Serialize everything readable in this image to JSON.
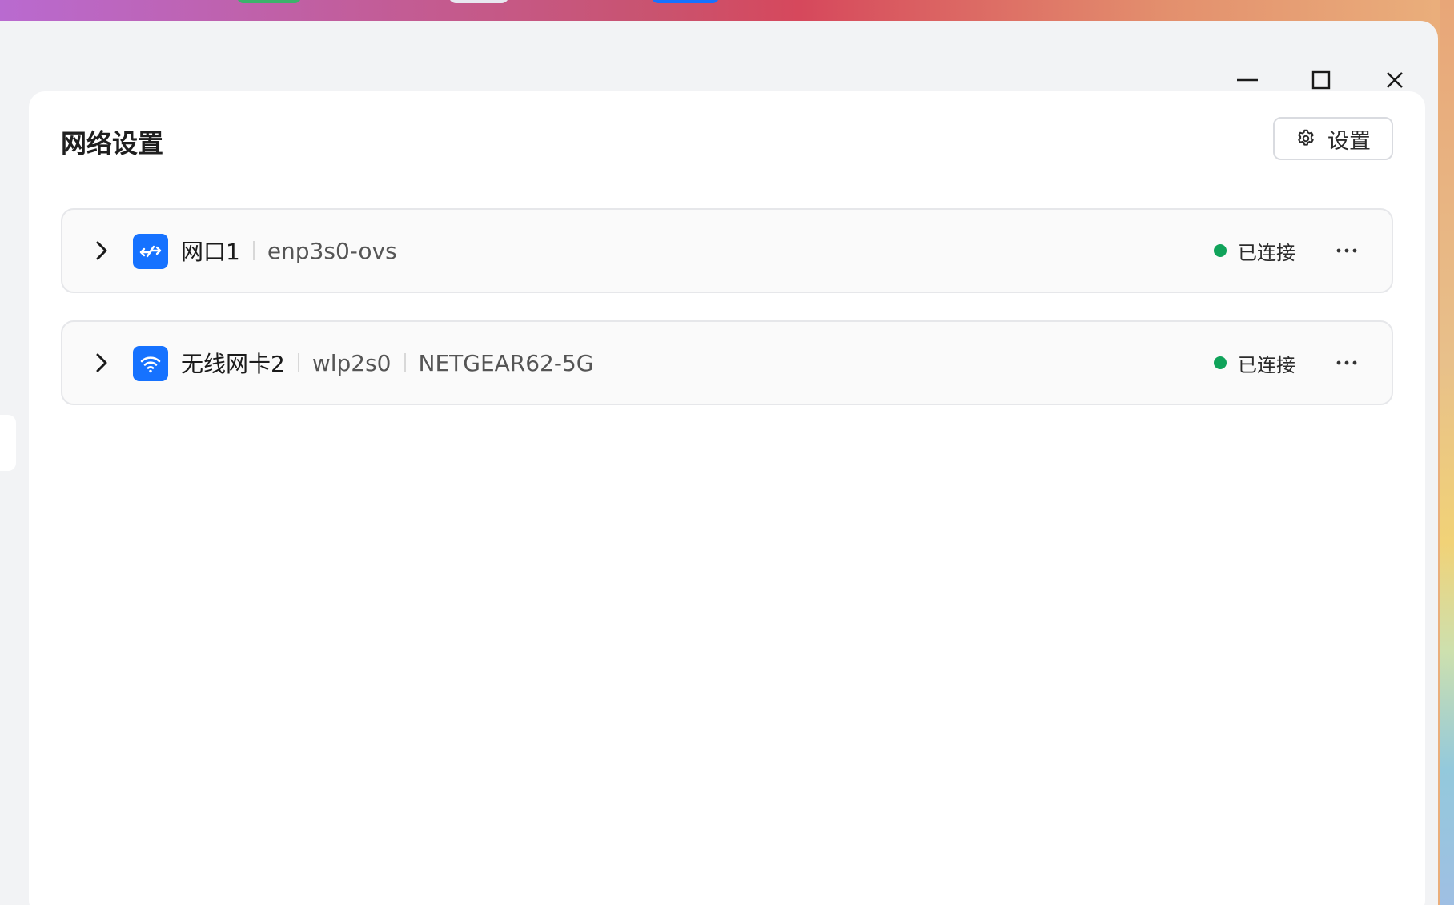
{
  "colors": {
    "accent": "#1672ff",
    "status_connected": "#10a35a",
    "window_bg": "#f2f3f5",
    "card_bg": "#ffffff",
    "row_bg": "#fafafa"
  },
  "window_controls": {
    "minimize_icon": "minimize-icon",
    "maximize_icon": "maximize-icon",
    "close_icon": "close-icon"
  },
  "header": {
    "title": "网络设置",
    "settings_label": "设置",
    "settings_icon": "gear-icon"
  },
  "interfaces": [
    {
      "name": "网口1",
      "device": "enp3s0-ovs",
      "ssid": null,
      "icon": "ethernet-swap-icon",
      "status": "已连接"
    },
    {
      "name": "无线网卡2",
      "device": "wlp2s0",
      "ssid": "NETGEAR62-5G",
      "icon": "wifi-icon",
      "status": "已连接"
    }
  ]
}
